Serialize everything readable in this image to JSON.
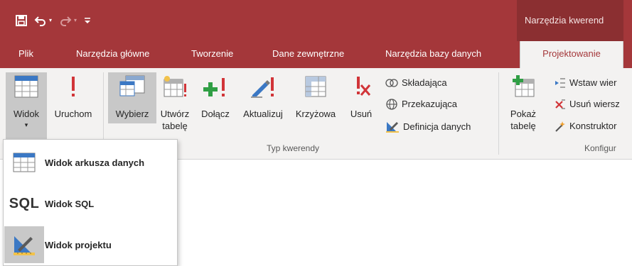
{
  "colors": {
    "accent": "#a4373a",
    "context_header": "#8b2f31",
    "ribbon_bg": "#f3f2f1"
  },
  "quick_access": {
    "icons": [
      "save-icon",
      "undo-icon",
      "redo-icon",
      "customize-qat-icon"
    ]
  },
  "context_header": "Narzędzia kwerend",
  "tabs": [
    {
      "label": "Plik"
    },
    {
      "label": "Narzędzia główne"
    },
    {
      "label": "Tworzenie"
    },
    {
      "label": "Dane zewnętrzne"
    },
    {
      "label": "Narzędzia bazy danych"
    },
    {
      "label": "Projektowanie",
      "active": true
    }
  ],
  "ribbon": {
    "results": {
      "widok_label": "Widok",
      "widok_arrow": "▾",
      "uruchom_label": "Uruchom"
    },
    "query_type": {
      "wybierz": "Wybierz",
      "utworz_line1": "Utwórz",
      "utworz_line2": "tabelę",
      "dolacz": "Dołącz",
      "aktualizuj": "Aktualizuj",
      "krzyzowa": "Krzyżowa",
      "usun": "Usuń",
      "skladajaca": "Składająca",
      "przekazujaca": "Przekazująca",
      "definicja": "Definicja danych",
      "group_label": "Typ kwerendy"
    },
    "query_setup": {
      "pokaz_line1": "Pokaż",
      "pokaz_line2": "tabelę",
      "wstaw": "Wstaw wier",
      "usun_wiersz": "Usuń wiersz",
      "konstruktor": "Konstruktor",
      "group_label": "Konfigur"
    }
  },
  "view_menu": {
    "items": [
      {
        "label": "Widok arkusza danych",
        "icon": "datasheet-icon"
      },
      {
        "label": "Widok SQL",
        "icon_text": "SQL"
      },
      {
        "label": "Widok projektu",
        "icon": "design-icon"
      }
    ]
  }
}
